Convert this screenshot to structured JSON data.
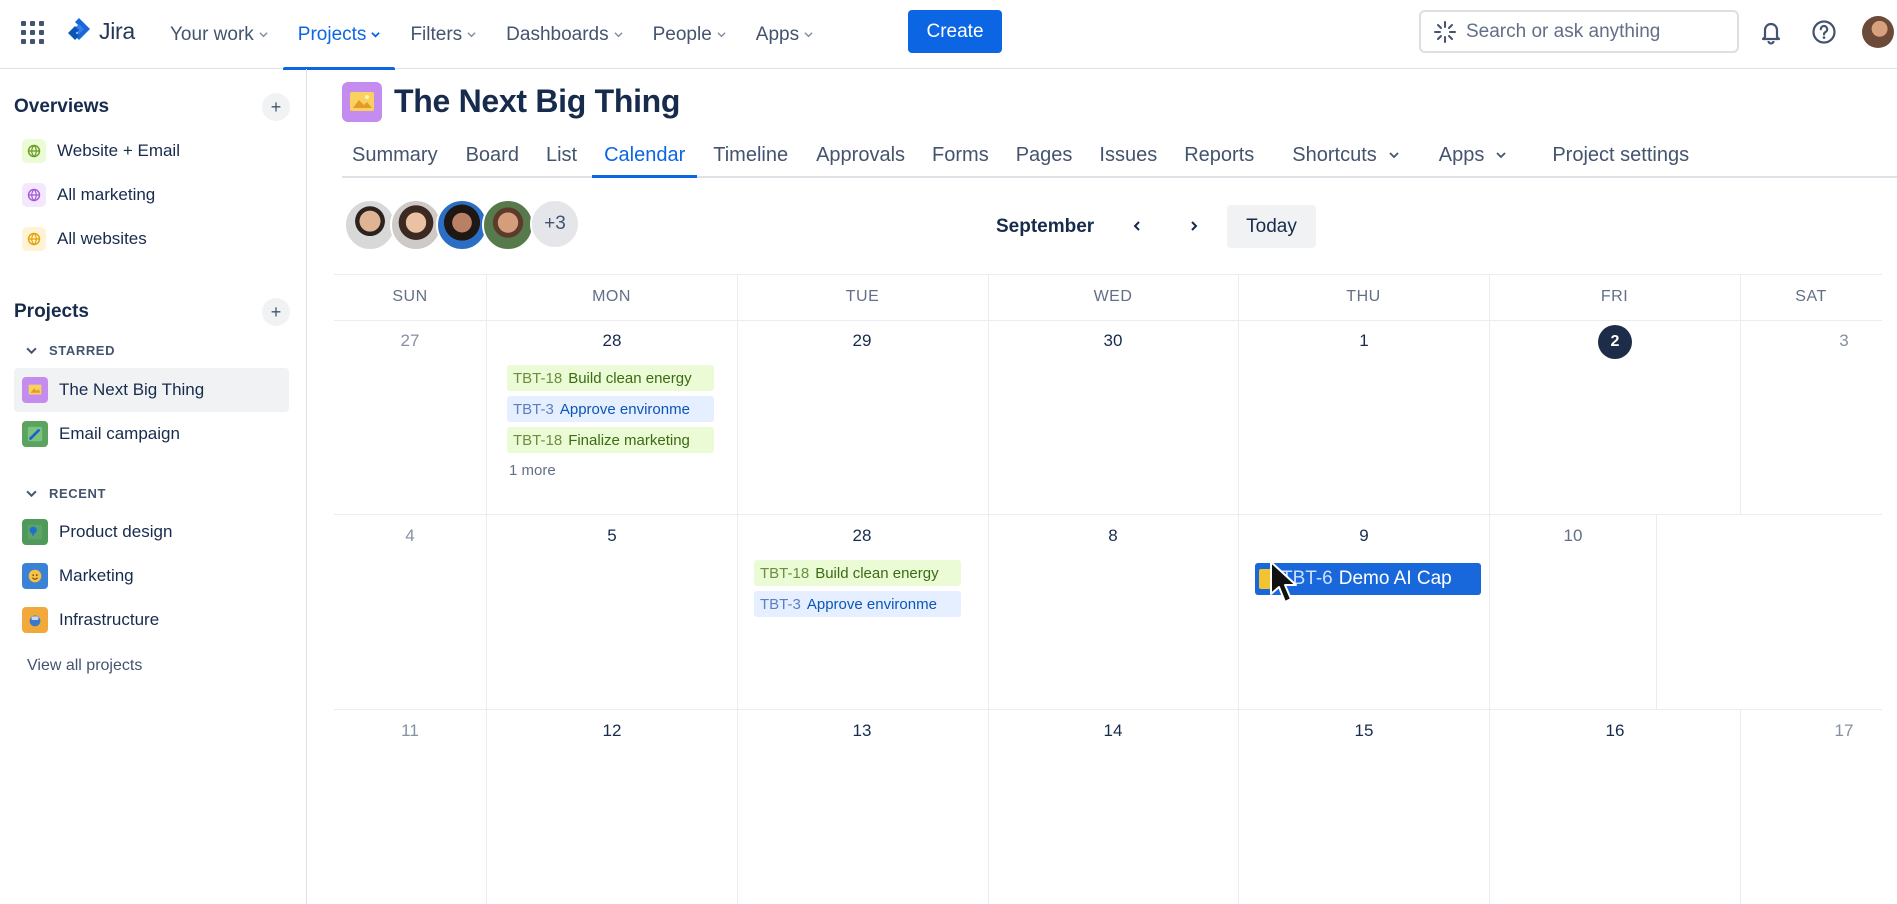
{
  "topnav": {
    "brand": "Jira",
    "items": [
      {
        "label": "Your work"
      },
      {
        "label": "Projects"
      },
      {
        "label": "Filters"
      },
      {
        "label": "Dashboards"
      },
      {
        "label": "People"
      },
      {
        "label": "Apps"
      }
    ],
    "create_label": "Create",
    "search_placeholder": "Search or ask anything",
    "accent": "#0c66e4"
  },
  "sidebar": {
    "overviews_heading": "Overviews",
    "overviews": [
      {
        "label": "Website + Email",
        "color": "#6a9a23",
        "bg": "#eafbd5"
      },
      {
        "label": "All marketing",
        "color": "#a259d9",
        "bg": "#f3e8fd"
      },
      {
        "label": "All websites",
        "color": "#e2a203",
        "bg": "#fff3d6"
      }
    ],
    "projects_heading": "Projects",
    "starred_heading": "STARRED",
    "starred": [
      {
        "label": "The Next Big Thing"
      },
      {
        "label": "Email campaign"
      }
    ],
    "recent_heading": "RECENT",
    "recent": [
      {
        "label": "Product design"
      },
      {
        "label": "Marketing"
      },
      {
        "label": "Infrastructure"
      }
    ],
    "view_all": "View all projects"
  },
  "project": {
    "title": "The Next Big Thing",
    "tabs": [
      {
        "label": "Summary"
      },
      {
        "label": "Board"
      },
      {
        "label": "List"
      },
      {
        "label": "Calendar"
      },
      {
        "label": "Timeline"
      },
      {
        "label": "Approvals"
      },
      {
        "label": "Forms"
      },
      {
        "label": "Pages"
      },
      {
        "label": "Issues"
      },
      {
        "label": "Reports"
      },
      {
        "label": "Shortcuts"
      },
      {
        "label": "Apps"
      },
      {
        "label": "Project settings"
      }
    ],
    "active_tab": "Calendar"
  },
  "calendar": {
    "avatars_more": "+3",
    "month": "September",
    "today_label": "Today",
    "days_of_week": [
      "SUN",
      "MON",
      "TUE",
      "WED",
      "THU",
      "FRI",
      "SAT"
    ],
    "weeks": [
      [
        "27",
        "28",
        "29",
        "30",
        "1",
        "2",
        "3"
      ],
      [
        "4",
        "5",
        "28",
        "8",
        "9",
        "10",
        ""
      ],
      [
        "11",
        "12",
        "13",
        "14",
        "15",
        "16",
        "17"
      ]
    ],
    "today_day": "2",
    "events": {
      "w1_mon": [
        {
          "key": "TBT-18",
          "title": "Build clean energy",
          "tone": "green"
        },
        {
          "key": "TBT-3",
          "title": "Approve environme",
          "tone": "blue"
        },
        {
          "key": "TBT-18",
          "title": "Finalize marketing",
          "tone": "green"
        }
      ],
      "w1_mon_more": "1 more",
      "w2_tue": [
        {
          "key": "TBT-18",
          "title": "Build clean energy",
          "tone": "green"
        },
        {
          "key": "TBT-3",
          "title": "Approve environme",
          "tone": "blue"
        }
      ],
      "dragging": {
        "key": "TBT-6",
        "title": "Demo AI Cap"
      }
    }
  }
}
